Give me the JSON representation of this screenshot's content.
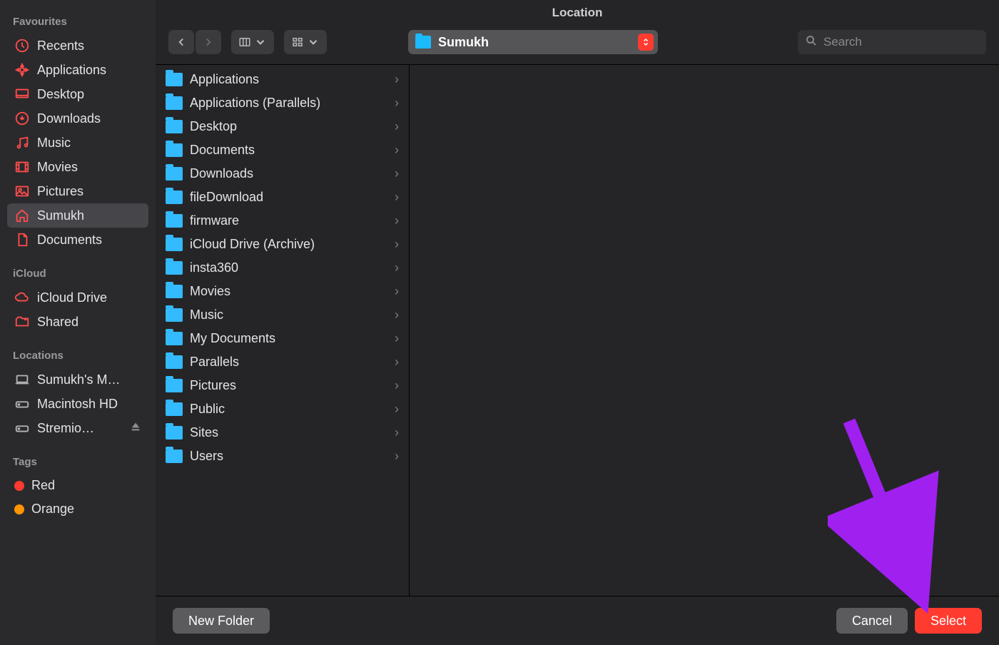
{
  "title": "Location",
  "sidebar": {
    "favourites": {
      "heading": "Favourites",
      "items": [
        {
          "icon": "recents",
          "label": "Recents"
        },
        {
          "icon": "applications",
          "label": "Applications"
        },
        {
          "icon": "desktop",
          "label": "Desktop"
        },
        {
          "icon": "downloads",
          "label": "Downloads"
        },
        {
          "icon": "music",
          "label": "Music"
        },
        {
          "icon": "movies",
          "label": "Movies"
        },
        {
          "icon": "pictures",
          "label": "Pictures"
        },
        {
          "icon": "home",
          "label": "Sumukh",
          "active": true
        },
        {
          "icon": "documents",
          "label": "Documents"
        }
      ]
    },
    "icloud": {
      "heading": "iCloud",
      "items": [
        {
          "icon": "cloud",
          "label": "iCloud Drive"
        },
        {
          "icon": "shared",
          "label": "Shared"
        }
      ]
    },
    "locations": {
      "heading": "Locations",
      "items": [
        {
          "icon": "laptop",
          "label": "Sumukh's M…",
          "mono": true
        },
        {
          "icon": "disk",
          "label": "Macintosh HD",
          "mono": true
        },
        {
          "icon": "disk",
          "label": "Stremio…",
          "mono": true,
          "eject": true
        }
      ]
    },
    "tags": {
      "heading": "Tags",
      "items": [
        {
          "color": "#ff3b30",
          "label": "Red"
        },
        {
          "color": "#ff9500",
          "label": "Orange"
        }
      ]
    }
  },
  "toolbar": {
    "path": "Sumukh",
    "search_placeholder": "Search"
  },
  "folders": [
    "Applications",
    "Applications (Parallels)",
    "Desktop",
    "Documents",
    "Downloads",
    "fileDownload",
    "firmware",
    "iCloud Drive (Archive)",
    "insta360",
    "Movies",
    "Music",
    "My Documents",
    "Parallels",
    "Pictures",
    "Public",
    "Sites",
    "Users"
  ],
  "footer": {
    "new_folder": "New Folder",
    "cancel": "Cancel",
    "select": "Select"
  }
}
